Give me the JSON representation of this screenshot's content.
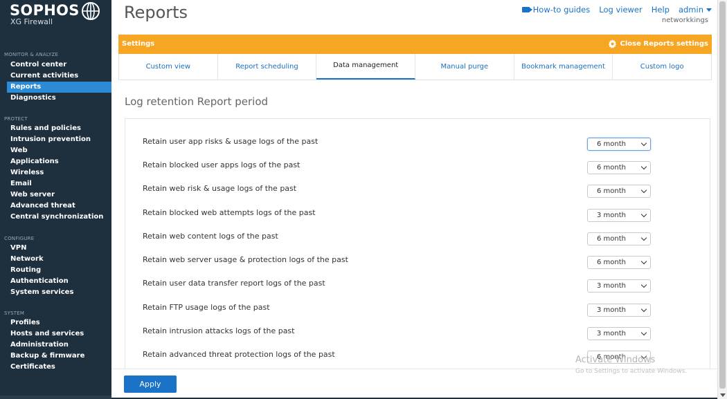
{
  "brand": {
    "name": "SOPHOS",
    "product": "XG Firewall"
  },
  "sidebar": {
    "sections": [
      {
        "title": "MONITOR & ANALYZE",
        "items": [
          "Control center",
          "Current activities",
          "Reports",
          "Diagnostics"
        ]
      },
      {
        "title": "PROTECT",
        "items": [
          "Rules and policies",
          "Intrusion prevention",
          "Web",
          "Applications",
          "Wireless",
          "Email",
          "Web server",
          "Advanced threat",
          "Central synchronization"
        ]
      },
      {
        "title": "CONFIGURE",
        "items": [
          "VPN",
          "Network",
          "Routing",
          "Authentication",
          "System services"
        ]
      },
      {
        "title": "SYSTEM",
        "items": [
          "Profiles",
          "Hosts and services",
          "Administration",
          "Backup & firmware",
          "Certificates"
        ]
      }
    ],
    "active_item": "Reports"
  },
  "header": {
    "title": "Reports",
    "links": {
      "howto": "How-to guides",
      "log_viewer": "Log viewer",
      "help": "Help",
      "user": "admin"
    },
    "org": "networkkings"
  },
  "settings_bar": {
    "label": "Settings",
    "close_label": "Close Reports settings"
  },
  "tabs": [
    "Custom view",
    "Report scheduling",
    "Data management",
    "Manual purge",
    "Bookmark management",
    "Custom logo"
  ],
  "active_tab": "Data management",
  "section_heading": "Log retention Report period",
  "retention_rows": [
    {
      "label": "Retain user app risks & usage logs of the past",
      "value": "6 month"
    },
    {
      "label": "Retain blocked user apps logs of the past",
      "value": "6 month"
    },
    {
      "label": "Retain web risk & usage logs of the past",
      "value": "6 month"
    },
    {
      "label": "Retain blocked web attempts logs of the past",
      "value": "3 month"
    },
    {
      "label": "Retain web content logs of the past",
      "value": "6 month"
    },
    {
      "label": "Retain web server usage & protection logs of the past",
      "value": "6 month"
    },
    {
      "label": "Retain user data transfer report logs of the past",
      "value": "3 month"
    },
    {
      "label": "Retain FTP usage logs of the past",
      "value": "3 month"
    },
    {
      "label": "Retain intrusion attacks logs of the past",
      "value": "3 month"
    },
    {
      "label": "Retain advanced threat protection logs of the past",
      "value": "6 month"
    }
  ],
  "footer": {
    "apply_label": "Apply"
  },
  "watermark": {
    "title": "Activate Windows",
    "subtitle": "Go to Settings to activate Windows."
  },
  "colors": {
    "sidebar_bg": "#1e2f3e",
    "active_nav": "#2c8bd6",
    "settings_bar": "#f7a623",
    "link": "#1a73c7"
  }
}
